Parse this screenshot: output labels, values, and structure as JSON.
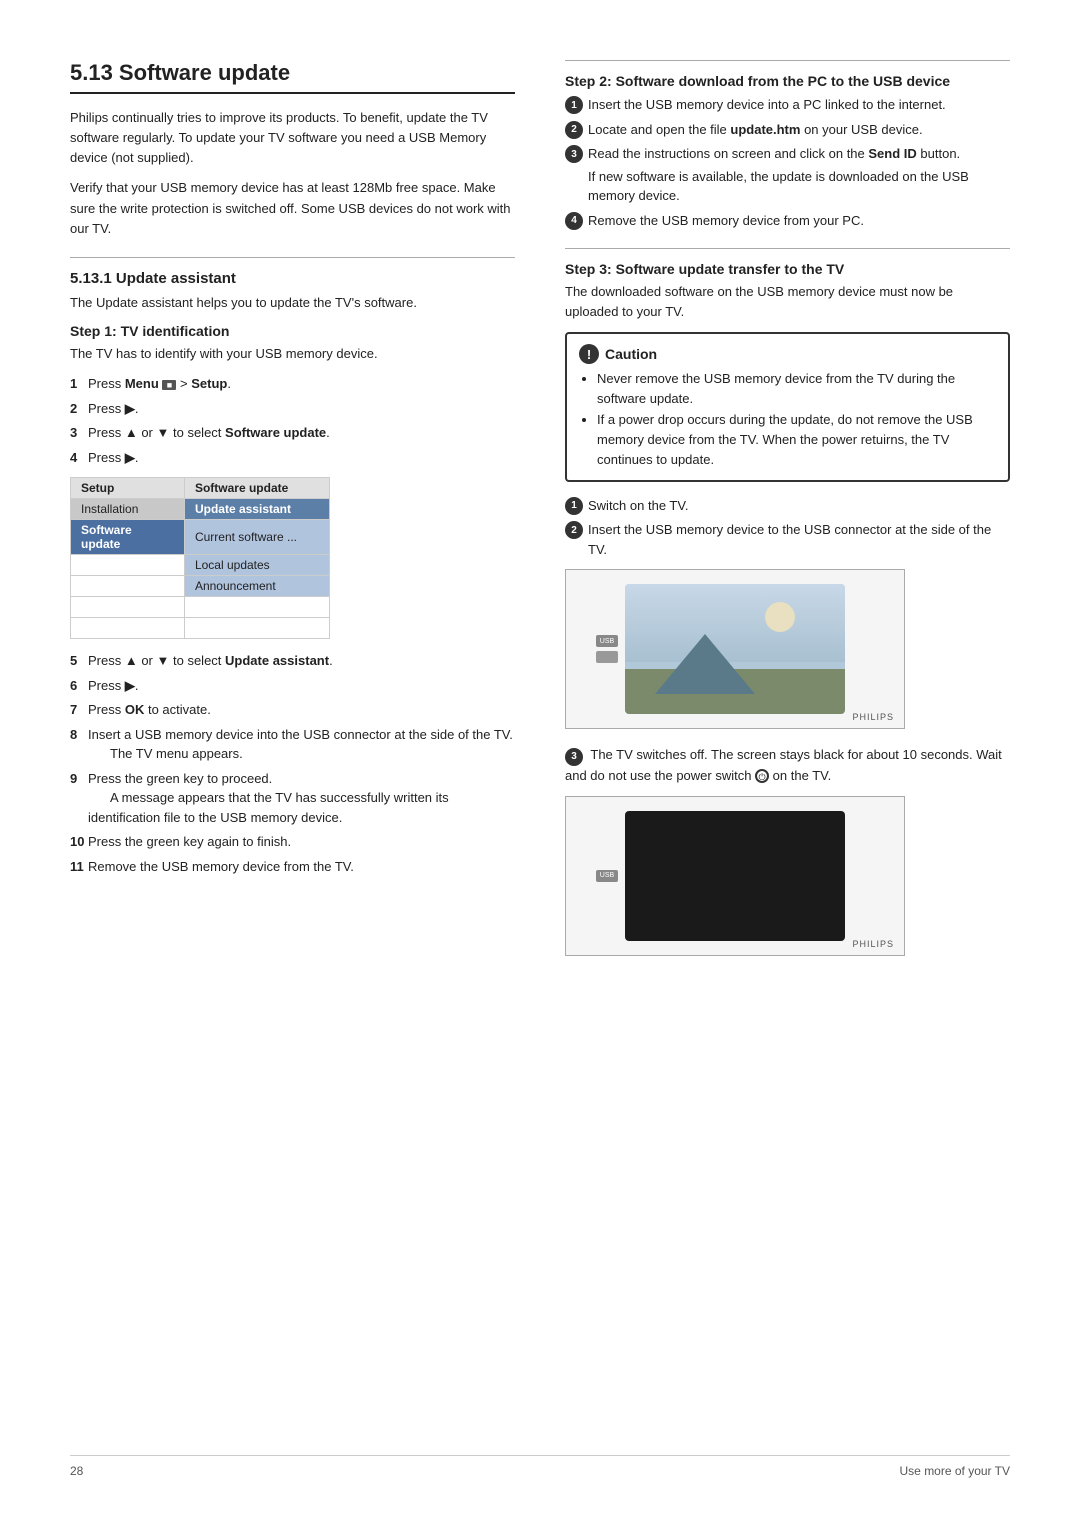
{
  "page": {
    "number": "28",
    "footer_right": "Use more of your TV"
  },
  "section": {
    "title": "5.13  Software update",
    "intro1": "Philips continually tries to improve its products. To benefit, update the TV software regularly. To update your TV software you need a USB Memory device (not supplied).",
    "intro2": "Verify that your USB memory device has at least 128Mb free space. Make sure the write protection is switched off. Some USB devices do not work with our TV.",
    "sub_section": "5.13.1  Update assistant",
    "sub_section_text": "The Update assistant helps you to update the TV's software.",
    "step1_title": "Step 1: TV identification",
    "step1_text": "The TV has to identify with your USB memory device.",
    "step1_items": [
      {
        "num": "1",
        "text": "Press Menu  > Setup."
      },
      {
        "num": "2",
        "text": "Press ▶."
      },
      {
        "num": "3",
        "text": "Press ▲ or ▼ to select Software update."
      },
      {
        "num": "4",
        "text": "Press ▶."
      }
    ],
    "menu_table": {
      "header": [
        "Setup",
        "Software update"
      ],
      "rows": [
        {
          "col1": "Installation",
          "col2": "Update assistant",
          "selected": true
        },
        {
          "col1": "Software update",
          "col2": "Current software ...",
          "highlight": true
        },
        {
          "col1": "",
          "col2": "Local updates",
          "highlight": false
        },
        {
          "col1": "",
          "col2": "Announcement",
          "highlight": false
        }
      ]
    },
    "step1_items2": [
      {
        "num": "5",
        "text": "Press ▲ or ▼ to select Update assistant."
      },
      {
        "num": "6",
        "text": "Press ▶."
      },
      {
        "num": "7",
        "text": "Press OK to activate."
      },
      {
        "num": "8",
        "text": "Insert a USB memory device into the USB connector at the side of the TV.",
        "sub": "The TV menu appears."
      },
      {
        "num": "9",
        "text": "Press the green key to proceed.",
        "sub": "A message appears that the TV has successfully written its identification file to the USB memory device."
      },
      {
        "num": "10",
        "text": "Press the green key again to finish."
      },
      {
        "num": "11",
        "text": "Remove the USB memory device from the TV."
      }
    ],
    "step2_title": "Step 2: Software download from the PC to the USB device",
    "step2_items": [
      {
        "num": "1",
        "text": "Insert the USB memory device into a PC linked to the internet."
      },
      {
        "num": "2",
        "text": "Locate and open the file update.htm on your USB device."
      },
      {
        "num": "3",
        "text": "Read the instructions on screen and click on the Send ID button.",
        "sub": "If new software is available, the update is downloaded on the USB memory device."
      },
      {
        "num": "4",
        "text": "Remove the USB memory device from your PC."
      }
    ],
    "step3_title": "Step 3: Software update transfer to the TV",
    "step3_text": "The downloaded software on the USB memory device must now be uploaded to your TV.",
    "caution_title": "Caution",
    "caution_items": [
      "Never remove the USB memory device from the TV during the software update.",
      "If a power drop occurs during the update, do not remove the USB memory device from the TV. When the power retuirns, the TV continues to update."
    ],
    "step3_items": [
      {
        "num": "1",
        "text": "Switch on the TV."
      },
      {
        "num": "2",
        "text": "Insert the USB memory device to the USB connector at the side of the TV."
      }
    ],
    "step3_note": "The TV switches off. The screen stays black for about 10 seconds. Wait and do not use the power switch  on the TV.",
    "step3_items2": []
  }
}
